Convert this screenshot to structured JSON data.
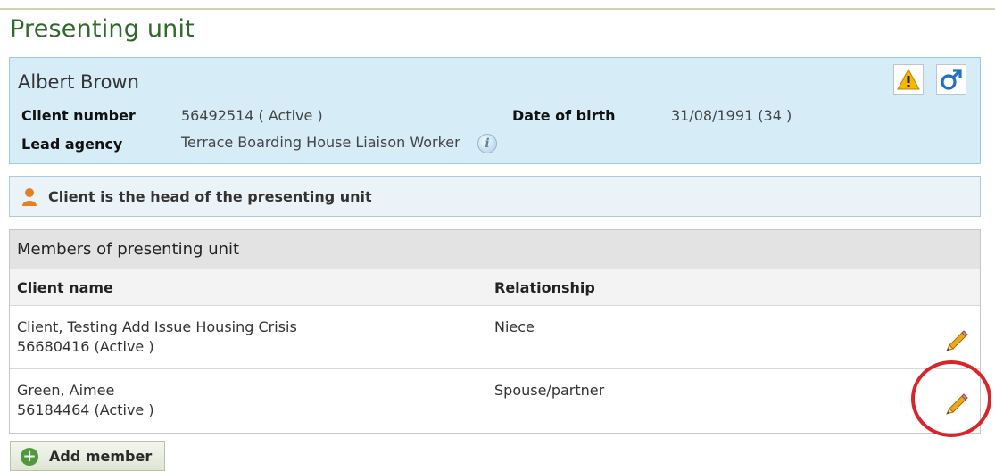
{
  "page": {
    "title": "Presenting unit"
  },
  "client": {
    "name": "Albert Brown",
    "fields": {
      "client_number_label": "Client number",
      "client_number_value": "56492514 ( Active )",
      "dob_label": "Date of birth",
      "dob_value": "31/08/1991 (34 )",
      "lead_agency_label": "Lead agency",
      "lead_agency_value": "Terrace Boarding House Liaison Worker"
    },
    "icons": [
      "warning-icon",
      "male-gender-icon",
      "info-icon"
    ]
  },
  "banner": {
    "text": "Client is the head of the presenting unit",
    "icon": "person-icon"
  },
  "members": {
    "heading": "Members of presenting unit",
    "columns": [
      "Client name",
      "Relationship"
    ],
    "rows": [
      {
        "name": "Client, Testing Add Issue Housing Crisis",
        "number": "56680416 (Active )",
        "relationship": "Niece"
      },
      {
        "name": "Green, Aimee",
        "number": "56184464 (Active )",
        "relationship": "Spouse/partner"
      }
    ]
  },
  "actions": {
    "add_member": "Add member"
  },
  "colors": {
    "title": "#2e6b2a",
    "panel": "#d6ecf7",
    "highlight": "#d6262b"
  }
}
